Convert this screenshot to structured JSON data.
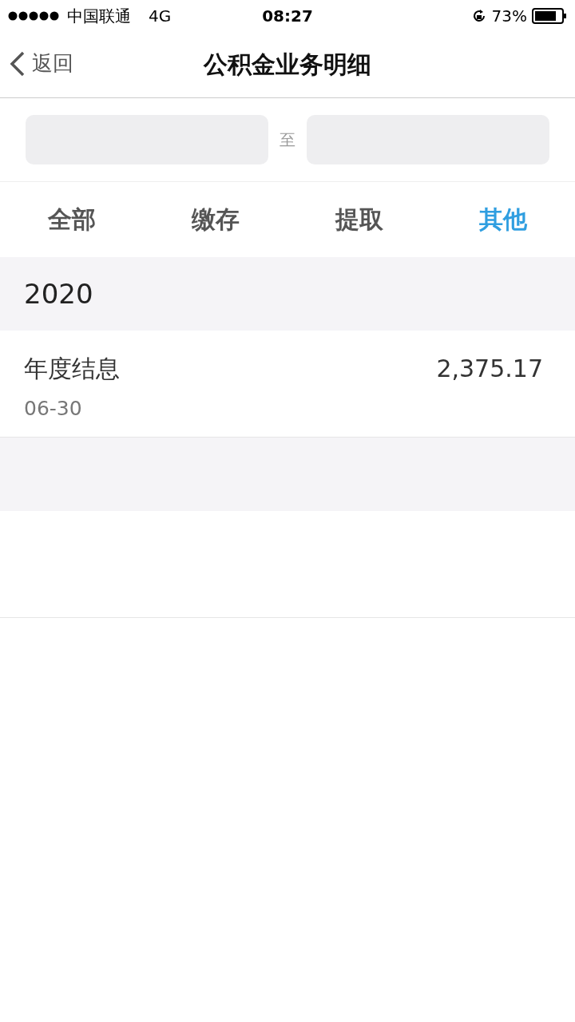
{
  "status_bar": {
    "carrier": "中国联通",
    "network": "4G",
    "time": "08:27",
    "battery_text": "73%"
  },
  "nav": {
    "back": "返回",
    "title": "公积金业务明细"
  },
  "date_range": {
    "separator": "至"
  },
  "tabs": [
    {
      "label": "全部",
      "selected": false
    },
    {
      "label": "缴存",
      "selected": false
    },
    {
      "label": "提取",
      "selected": false
    },
    {
      "label": "其他",
      "selected": true
    }
  ],
  "groups": [
    {
      "year": "2020",
      "rows": [
        {
          "title": "年度结息",
          "date": "06-30",
          "amount": "2,375.17"
        }
      ]
    },
    {
      "rows": [
        {}
      ]
    }
  ]
}
